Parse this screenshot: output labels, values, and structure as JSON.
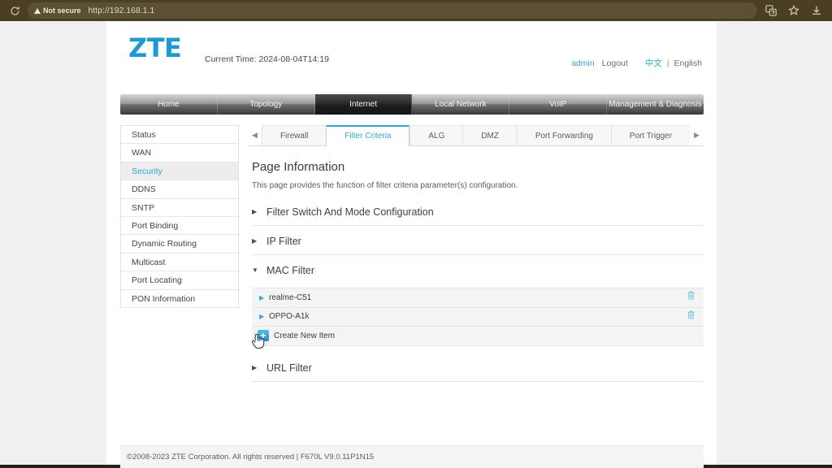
{
  "browser": {
    "reload_icon": "reload-icon",
    "security_label": "Not secure",
    "url": "http://192.168.1.1",
    "right_icons": [
      "translate-icon",
      "bookmark-star-icon",
      "download-icon"
    ]
  },
  "header": {
    "logo": "ZTE",
    "current_time": "Current Time: 2024-08-04T14:19",
    "user": "admin",
    "logout": "Logout",
    "lang_zh": "中文",
    "lang_sep": "|",
    "lang_en": "English"
  },
  "main_nav": {
    "items": [
      {
        "label": "Home",
        "active": false
      },
      {
        "label": "Topology",
        "active": false
      },
      {
        "label": "Internet",
        "active": true
      },
      {
        "label": "Local Network",
        "active": false
      },
      {
        "label": "VoIP",
        "active": false
      },
      {
        "label": "Management & Diagnosis",
        "active": false
      }
    ]
  },
  "sidebar": {
    "items": [
      {
        "label": "Status",
        "active": false
      },
      {
        "label": "WAN",
        "active": false
      },
      {
        "label": "Security",
        "active": true
      },
      {
        "label": "DDNS",
        "active": false
      },
      {
        "label": "SNTP",
        "active": false
      },
      {
        "label": "Port Binding",
        "active": false
      },
      {
        "label": "Dynamic Routing",
        "active": false
      },
      {
        "label": "Multicast",
        "active": false
      },
      {
        "label": "Port Locating",
        "active": false
      },
      {
        "label": "PON Information",
        "active": false
      }
    ]
  },
  "tabs": {
    "prev_arrow": "chevron-left-icon",
    "next_arrow": "chevron-right-icon",
    "items": [
      {
        "label": "Firewall",
        "active": false
      },
      {
        "label": "Filter Criteria",
        "active": true
      },
      {
        "label": "ALG",
        "active": false
      },
      {
        "label": "DMZ",
        "active": false
      },
      {
        "label": "Port Forwarding",
        "active": false
      },
      {
        "label": "Port Trigger",
        "active": false
      }
    ]
  },
  "panel": {
    "title": "Page Information",
    "description": "This page provides the function of filter criteria parameter(s) configuration.",
    "sections": [
      {
        "label": "Filter Switch And Mode Configuration",
        "expanded": false,
        "caret": "▶"
      },
      {
        "label": "IP Filter",
        "expanded": false,
        "caret": "▶"
      },
      {
        "label": "MAC Filter",
        "expanded": true,
        "caret": "▼"
      },
      {
        "label": "URL Filter",
        "expanded": false,
        "caret": "▶"
      }
    ],
    "mac_filter": {
      "label": "MAC Filter",
      "caret": "▼",
      "rows": [
        {
          "label": "realme-C51",
          "caret": "▶",
          "delete_icon": "trash-icon"
        },
        {
          "label": "OPPO-A1k",
          "caret": "▶",
          "delete_icon": "trash-icon"
        }
      ],
      "create_row": {
        "label": "Create New Item",
        "icon": "plus-icon"
      }
    }
  },
  "footer": {
    "text": "©2008-2023 ZTE Corporation. All rights reserved  |   F670L V9.0.11P1N15"
  },
  "colors": {
    "accent": "#2fa8cf",
    "logo_blue": "#1b9ad6",
    "chrome_bg": "#4a3f22",
    "page_bg": "#f0f0f0"
  }
}
